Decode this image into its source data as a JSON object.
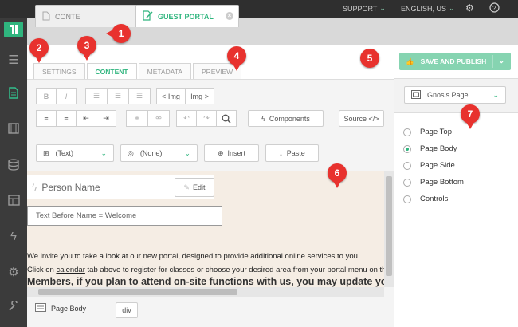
{
  "topbar": {
    "support": "SUPPORT",
    "language": "ENGLISH, US"
  },
  "tabs": [
    {
      "label": "CONTE",
      "icon": "document-icon"
    },
    {
      "label": "GUEST PORTAL",
      "icon": "edit-document-icon"
    }
  ],
  "subtabs": [
    "SETTINGS",
    "CONTENT",
    "METADATA",
    "PREVIEW"
  ],
  "toolbar": {
    "bold": "B",
    "italic": "I",
    "img_left": "< Img",
    "img_right": "Img >",
    "components": "Components",
    "source": "Source </>",
    "format_select": "(Text)",
    "class_select": "(None)",
    "insert": "Insert",
    "paste": "Paste"
  },
  "publish": {
    "label": "SAVE AND PUBLISH"
  },
  "page_select": {
    "value": "Gnosis Page"
  },
  "regions": [
    {
      "label": "Page Top",
      "selected": false
    },
    {
      "label": "Page Body",
      "selected": true
    },
    {
      "label": "Page Side",
      "selected": false
    },
    {
      "label": "Page Bottom",
      "selected": false
    },
    {
      "label": "Controls",
      "selected": false
    }
  ],
  "content": {
    "person_name": "Person Name",
    "edit": "Edit",
    "text_before": "Text Before Name = Welcome",
    "para1": "We invite you to take a look at our new portal, designed to provide additional online services to you.",
    "para2_pre": "Click on ",
    "para2_link": "calendar",
    "para2_post": " tab above to register for classes or choose your desired area from your portal menu on the si",
    "para3": "Members, if you plan to attend on-site functions with us, you may update you"
  },
  "bottom": {
    "region_label": "Page Body",
    "element_tag": "div"
  },
  "callouts": [
    "1",
    "2",
    "3",
    "4",
    "5",
    "6",
    "7"
  ],
  "colors": {
    "accent": "#2fb57e",
    "callout": "#e8322e",
    "dark": "#3b3b3b",
    "content_bg": "#f5ede4"
  }
}
